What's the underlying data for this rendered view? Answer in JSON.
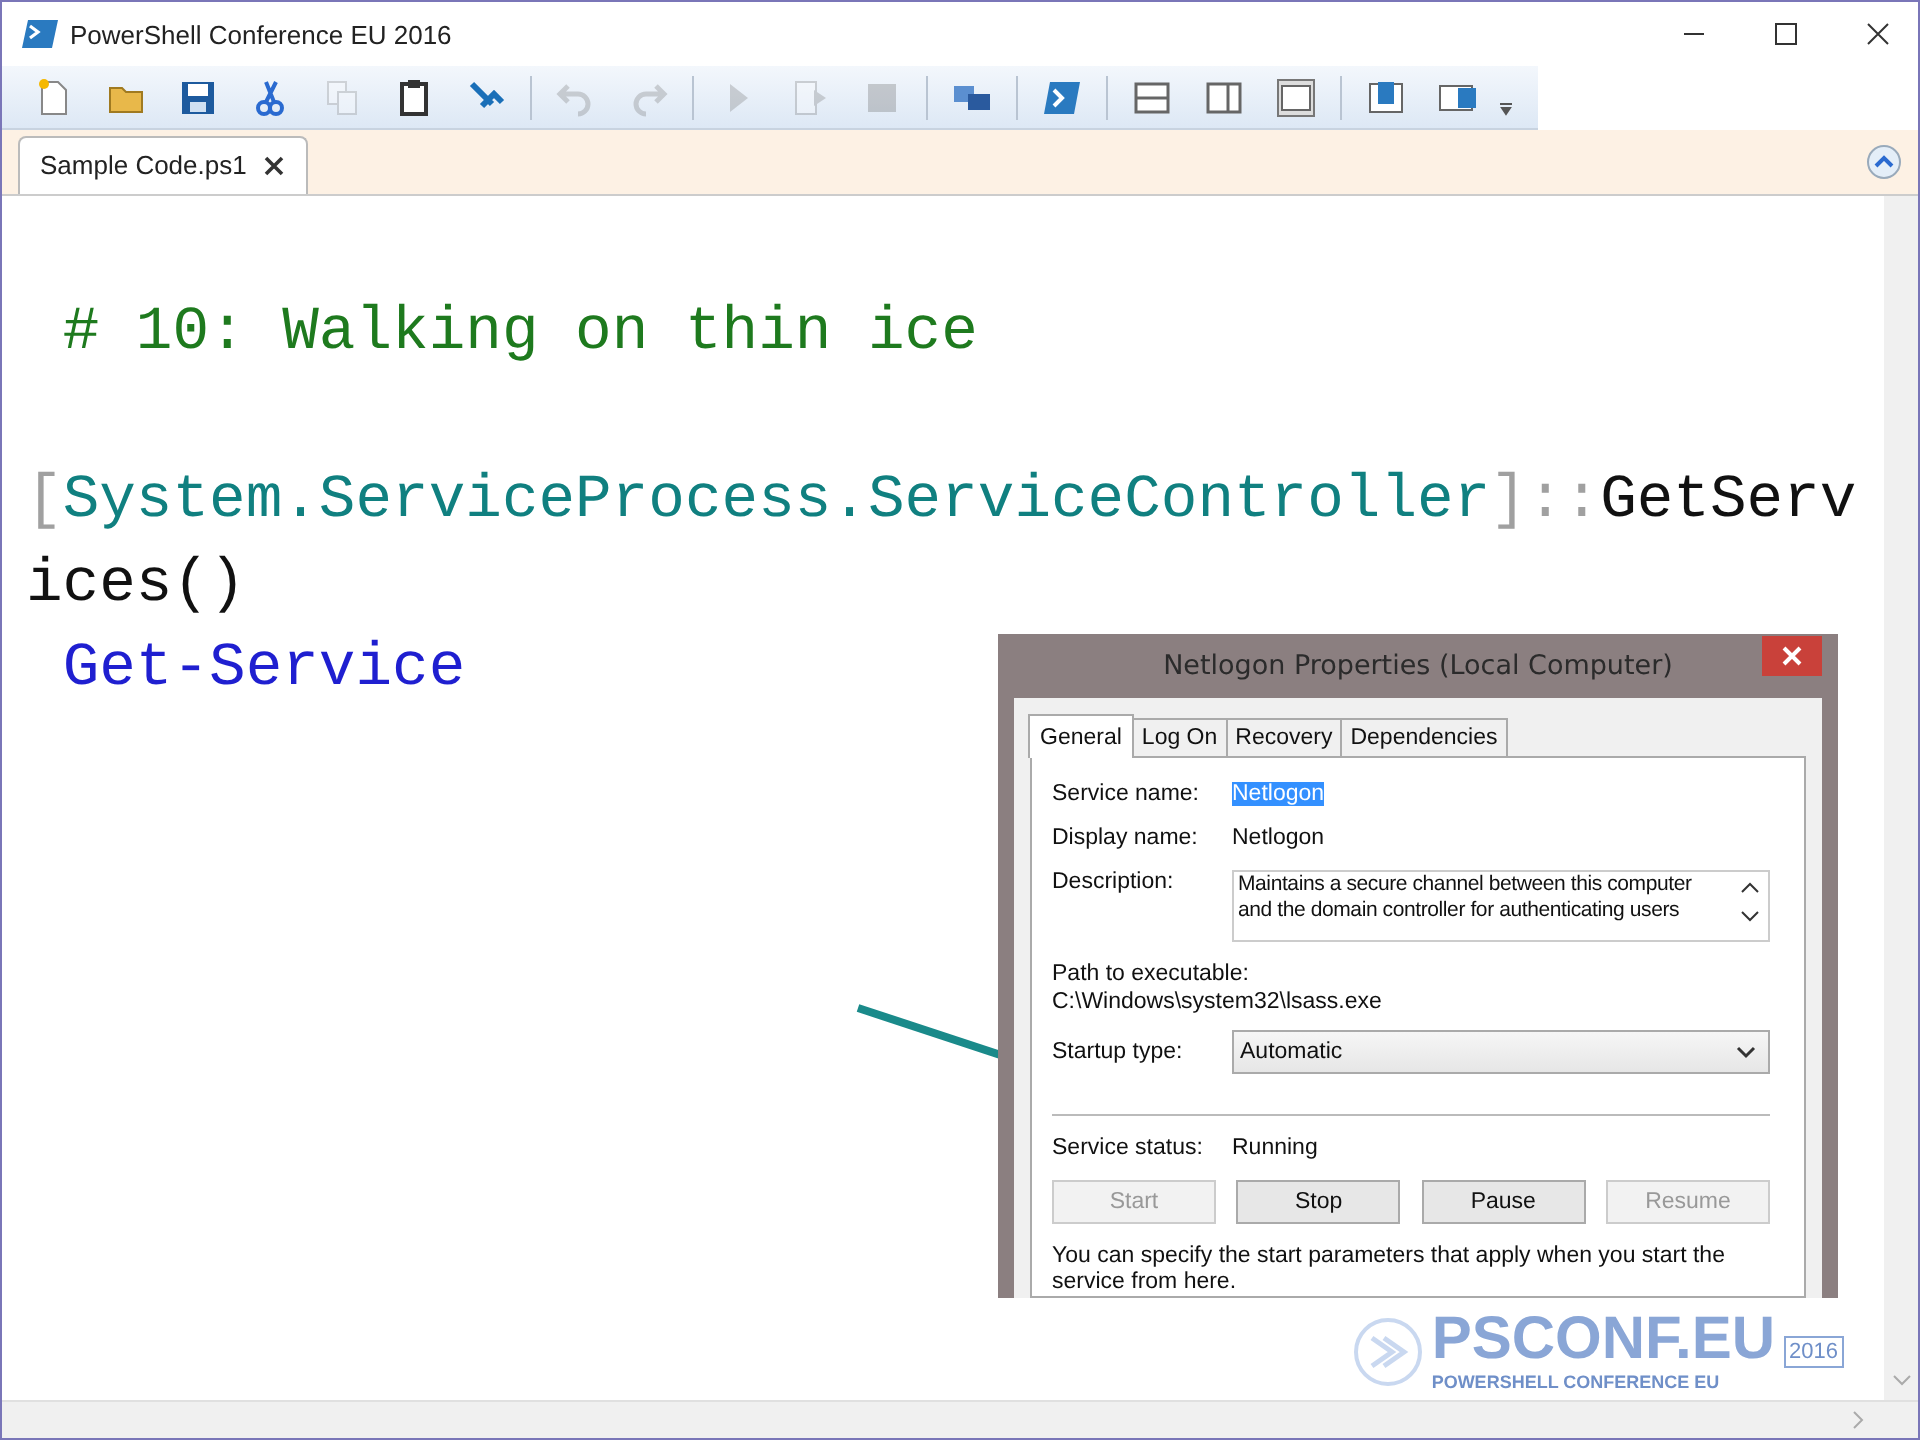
{
  "window": {
    "title": "PowerShell Conference EU 2016"
  },
  "toolbar": [
    {
      "kind": "new",
      "disabled": false
    },
    {
      "kind": "open",
      "disabled": false
    },
    {
      "kind": "save",
      "disabled": false
    },
    {
      "kind": "cut",
      "disabled": false
    },
    {
      "kind": "copy",
      "disabled": true
    },
    {
      "kind": "paste",
      "disabled": false
    },
    {
      "kind": "clear",
      "disabled": false
    },
    {
      "kind": "separator"
    },
    {
      "kind": "undo",
      "disabled": true
    },
    {
      "kind": "redo",
      "disabled": true
    },
    {
      "kind": "separator"
    },
    {
      "kind": "run",
      "disabled": true
    },
    {
      "kind": "run-selection",
      "disabled": true
    },
    {
      "kind": "stop",
      "disabled": true
    },
    {
      "kind": "separator"
    },
    {
      "kind": "remote",
      "disabled": false
    },
    {
      "kind": "separator"
    },
    {
      "kind": "console",
      "disabled": false
    },
    {
      "kind": "separator"
    },
    {
      "kind": "pane-top",
      "disabled": false
    },
    {
      "kind": "pane-right",
      "disabled": false
    },
    {
      "kind": "pane-max",
      "disabled": false
    },
    {
      "kind": "separator"
    },
    {
      "kind": "script-top",
      "disabled": false
    },
    {
      "kind": "script-right",
      "disabled": false
    }
  ],
  "tabs": [
    {
      "label": "Sample Code.ps1",
      "selected": true
    }
  ],
  "editor": {
    "lines": [
      {
        "tokens": [
          {
            "kind": "comment",
            "text": " # 10: Walking on thin ice"
          }
        ]
      },
      {
        "tokens": [
          {
            "kind": "operator",
            "text": "["
          },
          {
            "kind": "type",
            "text": "System.ServiceProcess.ServiceController"
          },
          {
            "kind": "operator",
            "text": "]::"
          },
          {
            "kind": "plain",
            "text": "GetServices()"
          }
        ]
      },
      {
        "tokens": [
          {
            "kind": "command",
            "text": " Get-Service"
          }
        ]
      }
    ]
  },
  "dialog": {
    "title": "Netlogon Properties (Local Computer)",
    "tabs": [
      {
        "label": "General",
        "selected": true
      },
      {
        "label": "Log On",
        "selected": false
      },
      {
        "label": "Recovery",
        "selected": false
      },
      {
        "label": "Dependencies",
        "selected": false
      }
    ],
    "service_name": {
      "label": "Service name:",
      "value": "Netlogon",
      "selected": true
    },
    "display_name": {
      "label": "Display name:",
      "value": "Netlogon"
    },
    "description": {
      "label": "Description:",
      "value": "Maintains a secure channel between this computer and the domain controller for authenticating users"
    },
    "path": {
      "label": "Path to executable:",
      "value": "C:\\Windows\\system32\\lsass.exe"
    },
    "startup_type": {
      "label": "Startup type:",
      "value": "Automatic"
    },
    "service_status": {
      "label": "Service status:",
      "value": "Running"
    },
    "buttons": [
      {
        "label": "Start",
        "disabled": true
      },
      {
        "label": "Stop",
        "disabled": false
      },
      {
        "label": "Pause",
        "disabled": false
      },
      {
        "label": "Resume",
        "disabled": true
      }
    ],
    "note": "You can specify the start parameters that apply when you start the service from here."
  },
  "logo": {
    "name": "PSCONF.EU",
    "subtitle": "POWERSHELL CONFERENCE EU",
    "year": "2016"
  }
}
